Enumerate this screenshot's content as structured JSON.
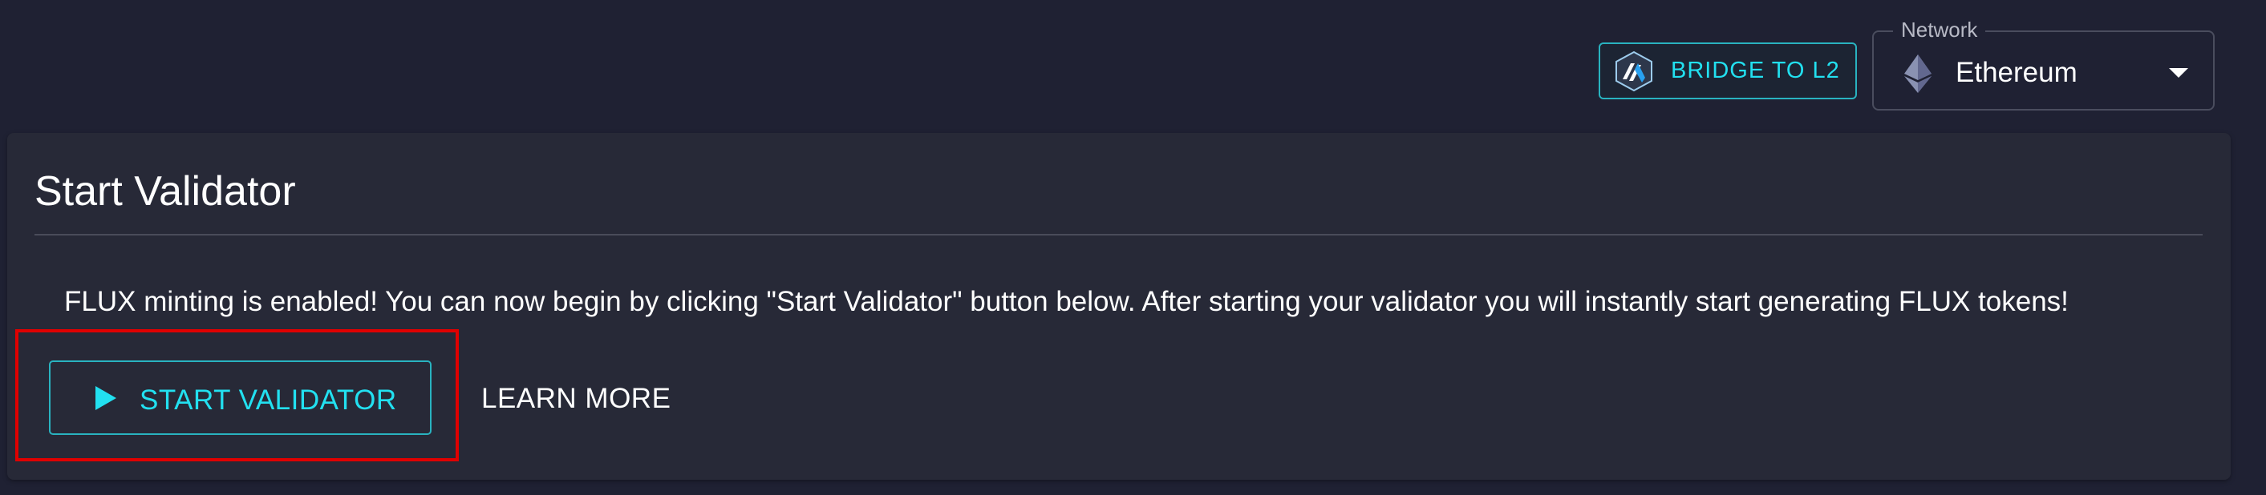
{
  "header": {
    "bridge_button": {
      "label": "BRIDGE TO L2",
      "icon": "arbitrum-logo-icon"
    },
    "network_select": {
      "legend": "Network",
      "value": "Ethereum",
      "icon": "ethereum-icon"
    }
  },
  "validator_card": {
    "title": "Start Validator",
    "message": "FLUX minting is enabled! You can now begin by clicking \"Start Validator\" button below. After starting your validator you will instantly start generating FLUX tokens!",
    "start_button": {
      "label": "START VALIDATOR",
      "icon": "play-icon"
    },
    "learn_more_label": "LEARN MORE"
  },
  "colors": {
    "background": "#1f2133",
    "card": "#272937",
    "accent": "#22e0f0",
    "accent_border": "#29b3c0",
    "highlight": "#e00000"
  }
}
